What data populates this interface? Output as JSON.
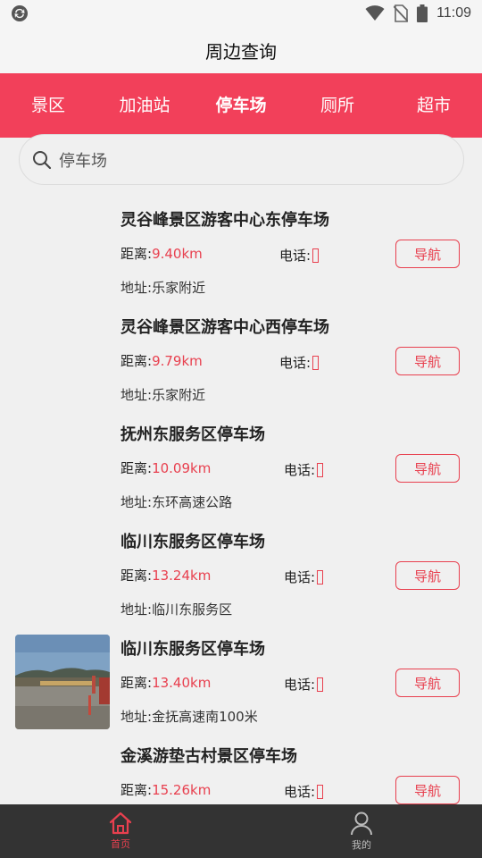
{
  "status_bar": {
    "time": "11:09",
    "icons": [
      "sync-icon",
      "wifi-icon",
      "no-sim-icon",
      "battery-icon"
    ]
  },
  "header": {
    "title": "周边查询"
  },
  "tabs": [
    {
      "label": "景区",
      "active": false
    },
    {
      "label": "加油站",
      "active": false
    },
    {
      "label": "停车场",
      "active": true
    },
    {
      "label": "厕所",
      "active": false
    },
    {
      "label": "超市",
      "active": false
    }
  ],
  "search": {
    "value": "停车场",
    "placeholder": ""
  },
  "labels": {
    "distance": "距离:",
    "phone": "电话:",
    "address": "地址:",
    "navigate": "导航"
  },
  "items": [
    {
      "name": "灵谷峰景区游客中心东停车场",
      "distance": "9.40km",
      "address": "乐家附近",
      "has_image": false
    },
    {
      "name": "灵谷峰景区游客中心西停车场",
      "distance": "9.79km",
      "address": "乐家附近",
      "has_image": false
    },
    {
      "name": "抚州东服务区停车场",
      "distance": "10.09km",
      "address": "东环高速公路",
      "has_image": false
    },
    {
      "name": "临川东服务区停车场",
      "distance": "13.24km",
      "address": "临川东服务区",
      "has_image": false
    },
    {
      "name": "临川东服务区停车场",
      "distance": "13.40km",
      "address": "金抚高速南100米",
      "has_image": true
    },
    {
      "name": "金溪游垫古村景区停车场",
      "distance": "15.26km",
      "address": "",
      "has_image": false
    }
  ],
  "bottom_nav": [
    {
      "label": "首页",
      "icon": "home-icon",
      "active": true
    },
    {
      "label": "我的",
      "icon": "user-icon",
      "active": false
    }
  ],
  "colors": {
    "accent": "#f2405a",
    "distance": "#e8404f",
    "bottom_bar": "#333333"
  }
}
